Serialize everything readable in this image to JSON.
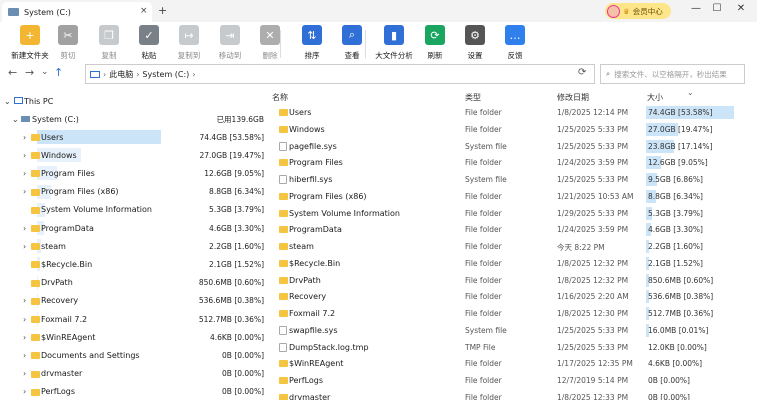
{
  "window": {
    "tab_title": "System (C:)",
    "tab_close": "×",
    "new_tab": "+",
    "vip_label": "会员中心",
    "min": "—",
    "max": "☐",
    "close": "✕"
  },
  "toolbar": [
    {
      "label": "新建文件夹",
      "icon": "new-folder-icon",
      "color": "#f2b632",
      "disabled": false,
      "glyph": "+"
    },
    {
      "label": "剪切",
      "icon": "scissors-icon",
      "color": "#555555",
      "disabled": true,
      "glyph": "✂"
    },
    {
      "label": "复制",
      "icon": "copy-icon",
      "color": "#9aa0a6",
      "disabled": true,
      "glyph": "❐"
    },
    {
      "label": "粘贴",
      "icon": "paste-icon",
      "color": "#7a8087",
      "disabled": false,
      "glyph": "✓"
    },
    {
      "label": "复制到",
      "icon": "copy-to-icon",
      "color": "#9aa0a6",
      "disabled": true,
      "glyph": "↦"
    },
    {
      "label": "移动到",
      "icon": "move-to-icon",
      "color": "#9aa0a6",
      "disabled": true,
      "glyph": "⇥"
    },
    {
      "label": "删除",
      "icon": "delete-icon",
      "color": "#6b6b6b",
      "disabled": true,
      "glyph": "✕"
    },
    {
      "label": "排序",
      "icon": "sort-icon",
      "color": "#2f6fd6",
      "disabled": false,
      "glyph": "⇅"
    },
    {
      "label": "查看",
      "icon": "view-icon",
      "color": "#2f6fd6",
      "disabled": false,
      "glyph": "⌕"
    },
    {
      "label": "大文件分析",
      "icon": "large-file-analysis-icon",
      "color": "#2f6fd6",
      "disabled": false,
      "glyph": "▮"
    },
    {
      "label": "刷新",
      "icon": "refresh-icon",
      "color": "#1aa560",
      "disabled": false,
      "glyph": "⟳"
    },
    {
      "label": "设置",
      "icon": "gear-icon",
      "color": "#555555",
      "disabled": false,
      "glyph": "⚙"
    },
    {
      "label": "反馈",
      "icon": "feedback-icon",
      "color": "#2f80ed",
      "disabled": false,
      "glyph": "…"
    }
  ],
  "address": {
    "crumbs": [
      "此电脑",
      "System (C:)"
    ],
    "search_placeholder": "搜索文件、以空格隔开，秒出结果"
  },
  "tree": {
    "this_pc": "This PC",
    "drive": {
      "name": "System (C:)",
      "size": "已用139.6GB"
    },
    "items": [
      {
        "name": "Users",
        "size": "74.4GB [53.58%]",
        "pct": 53.58,
        "expandable": true
      },
      {
        "name": "Windows",
        "size": "27.0GB [19.47%]",
        "pct": 19.47,
        "expandable": true
      },
      {
        "name": "Program Files",
        "size": "12.6GB [9.05%]",
        "pct": 9.05,
        "expandable": true
      },
      {
        "name": "Program Files (x86)",
        "size": "8.8GB [6.34%]",
        "pct": 6.34,
        "expandable": true
      },
      {
        "name": "System Volume Information",
        "size": "5.3GB [3.79%]",
        "pct": 3.79,
        "expandable": false
      },
      {
        "name": "ProgramData",
        "size": "4.6GB [3.30%]",
        "pct": 3.3,
        "expandable": true
      },
      {
        "name": "steam",
        "size": "2.2GB [1.60%]",
        "pct": 1.6,
        "expandable": true
      },
      {
        "name": "$Recycle.Bin",
        "size": "2.1GB [1.52%]",
        "pct": 1.52,
        "expandable": false
      },
      {
        "name": "DrvPath",
        "size": "850.6MB [0.60%]",
        "pct": 0.6,
        "expandable": false
      },
      {
        "name": "Recovery",
        "size": "536.6MB [0.38%]",
        "pct": 0.38,
        "expandable": true
      },
      {
        "name": "Foxmail 7.2",
        "size": "512.7MB [0.36%]",
        "pct": 0.36,
        "expandable": true
      },
      {
        "name": "$WinREAgent",
        "size": "4.6KB [0.00%]",
        "pct": 0,
        "expandable": true
      },
      {
        "name": "Documents and Settings",
        "size": "0B [0.00%]",
        "pct": 0,
        "expandable": true
      },
      {
        "name": "drvmaster",
        "size": "0B [0.00%]",
        "pct": 0,
        "expandable": true
      },
      {
        "name": "PerfLogs",
        "size": "0B [0.00%]",
        "pct": 0,
        "expandable": true
      }
    ]
  },
  "list": {
    "headers": {
      "name": "名称",
      "type": "类型",
      "date": "修改日期",
      "size": "大小"
    },
    "rows": [
      {
        "name": "Users",
        "type": "File folder",
        "date": "1/8/2025 12:14 PM",
        "size": "74.4GB [53.58%]",
        "pct": 53.58,
        "file": false
      },
      {
        "name": "Windows",
        "type": "File folder",
        "date": "1/25/2025 5:33 PM",
        "size": "27.0GB [19.47%]",
        "pct": 19.47,
        "file": false
      },
      {
        "name": "pagefile.sys",
        "type": "System file",
        "date": "1/25/2025 5:33 PM",
        "size": "23.8GB [17.14%]",
        "pct": 17.14,
        "file": true
      },
      {
        "name": "Program Files",
        "type": "File folder",
        "date": "1/24/2025 3:59 PM",
        "size": "12.6GB [9.05%]",
        "pct": 9.05,
        "file": false
      },
      {
        "name": "hiberfil.sys",
        "type": "System file",
        "date": "1/25/2025 5:33 PM",
        "size": "9.5GB [6.86%]",
        "pct": 6.86,
        "file": true
      },
      {
        "name": "Program Files (x86)",
        "type": "File folder",
        "date": "1/21/2025 10:53 AM",
        "size": "8.8GB [6.34%]",
        "pct": 6.34,
        "file": false
      },
      {
        "name": "System Volume Information",
        "type": "File folder",
        "date": "1/29/2025 5:33 PM",
        "size": "5.3GB [3.79%]",
        "pct": 3.79,
        "file": false
      },
      {
        "name": "ProgramData",
        "type": "File folder",
        "date": "1/24/2025 3:59 PM",
        "size": "4.6GB [3.30%]",
        "pct": 3.3,
        "file": false
      },
      {
        "name": "steam",
        "type": "File folder",
        "date": "今天 8:22 PM",
        "size": "2.2GB [1.60%]",
        "pct": 1.6,
        "file": false
      },
      {
        "name": "$Recycle.Bin",
        "type": "File folder",
        "date": "1/8/2025 12:32 PM",
        "size": "2.1GB [1.52%]",
        "pct": 1.52,
        "file": false
      },
      {
        "name": "DrvPath",
        "type": "File folder",
        "date": "1/8/2025 12:32 PM",
        "size": "850.6MB [0.60%]",
        "pct": 0.6,
        "file": false
      },
      {
        "name": "Recovery",
        "type": "File folder",
        "date": "1/16/2025 2:20 AM",
        "size": "536.6MB [0.38%]",
        "pct": 0.38,
        "file": false
      },
      {
        "name": "Foxmail 7.2",
        "type": "File folder",
        "date": "1/8/2025 12:30 PM",
        "size": "512.7MB [0.36%]",
        "pct": 0.36,
        "file": false
      },
      {
        "name": "swapfile.sys",
        "type": "System file",
        "date": "1/25/2025 5:33 PM",
        "size": "16.0MB [0.01%]",
        "pct": 0.01,
        "file": true
      },
      {
        "name": "DumpStack.log.tmp",
        "type": "TMP File",
        "date": "1/25/2025 5:33 PM",
        "size": "12.0KB [0.00%]",
        "pct": 0,
        "file": true
      },
      {
        "name": "$WinREAgent",
        "type": "File folder",
        "date": "1/17/2025 12:35 PM",
        "size": "4.6KB [0.00%]",
        "pct": 0,
        "file": false
      },
      {
        "name": "PerfLogs",
        "type": "File folder",
        "date": "12/7/2019 5:14 PM",
        "size": "0B [0.00%]",
        "pct": 0,
        "file": false
      },
      {
        "name": "drvmaster",
        "type": "File folder",
        "date": "1/8/2025 12:33 PM",
        "size": "0B [0.00%]",
        "pct": 0,
        "file": false
      }
    ]
  }
}
